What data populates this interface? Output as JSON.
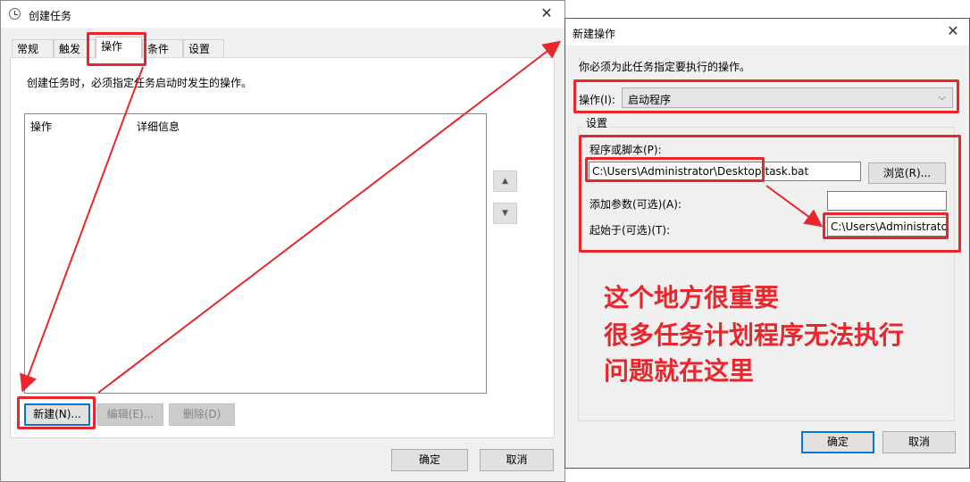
{
  "left_dialog": {
    "title": "创建任务",
    "tabs": [
      "常规",
      "触发器",
      "操作",
      "条件",
      "设置"
    ],
    "active_tab": "操作",
    "description": "创建任务时，必须指定任务启动时发生的操作。",
    "columns": [
      "操作",
      "详细信息"
    ],
    "buttons": {
      "new": "新建(N)...",
      "edit": "编辑(E)...",
      "delete": "删除(D)"
    },
    "ok": "确定",
    "cancel": "取消"
  },
  "right_dialog": {
    "title": "新建操作",
    "instruction": "你必须为此任务指定要执行的操作。",
    "action_label": "操作(I):",
    "action_value": "启动程序",
    "settings_label": "设置",
    "program_label": "程序或脚本(P):",
    "program_value": "C:\\Users\\Administrator\\Desktop\\task.bat",
    "browse": "浏览(R)...",
    "args_label": "添加参数(可选)(A):",
    "args_value": "",
    "startin_label": "起始于(可选)(T):",
    "startin_value": "C:\\Users\\Administrato",
    "ok": "确定",
    "cancel": "取消"
  },
  "annotation": {
    "line1": "这个地方很重要",
    "line2": "很多任务计划程序无法执行",
    "line3": "问题就在这里"
  },
  "colors": {
    "annotation_red": "#e8262b",
    "accent": "#0078d7"
  }
}
